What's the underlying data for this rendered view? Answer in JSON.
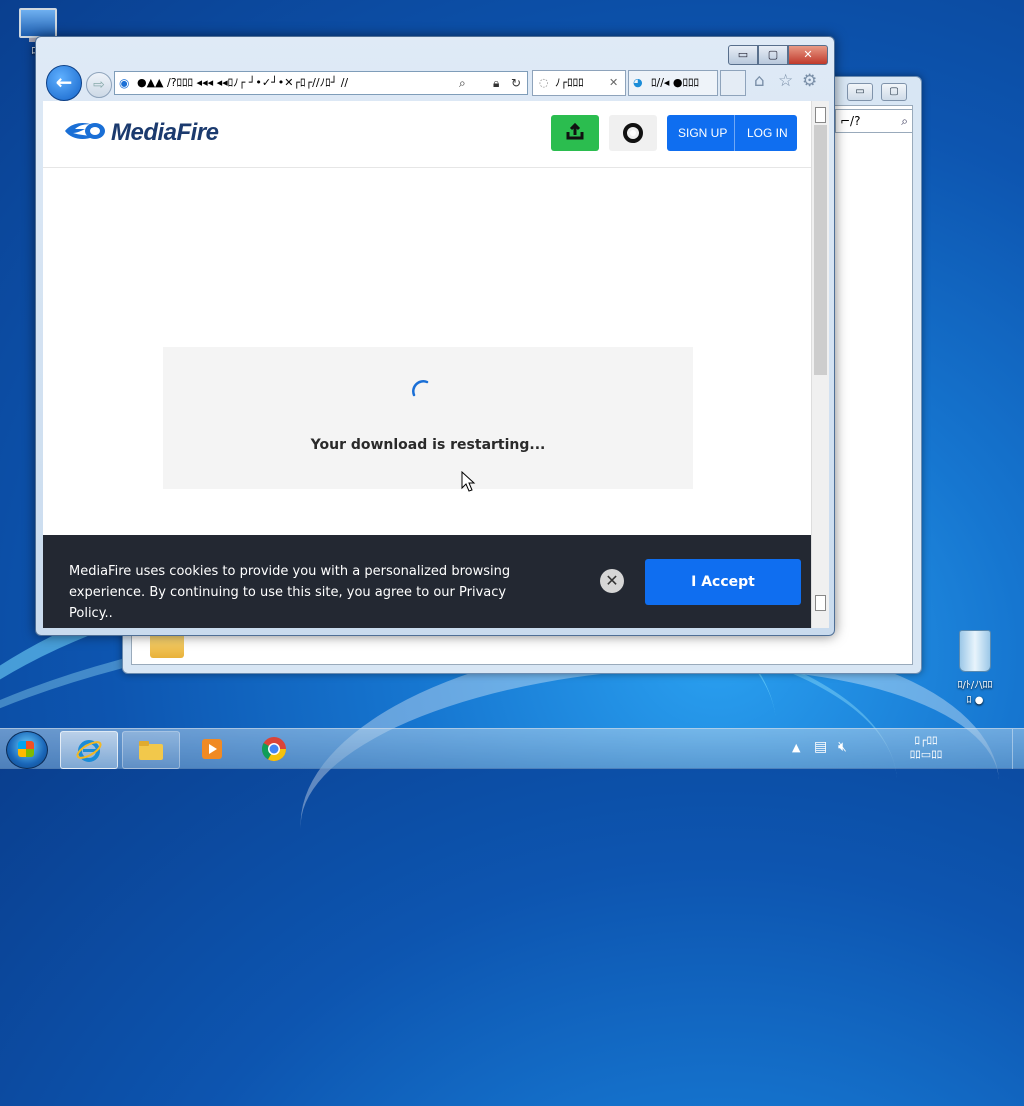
{
  "desktop": {
    "computer_label": "ﾛ/ﾉ",
    "recycle_label_line1": "ﾛ/ﾄ/ﾉ\\ﾛﾛ",
    "recycle_label_line2": "ﾛ ●"
  },
  "background_window": {
    "search_text": "⌐/?",
    "min_label": "▭",
    "max_label": "▢",
    "close_label": "✕"
  },
  "browser": {
    "window_controls": {
      "minimize": "▭",
      "maximize": "▢",
      "close": "✕"
    },
    "back_label": "←",
    "forward_label": "⇨",
    "address_text": "●▲▲ ∕?ﾛﾛﾛ ◂◂◂ ◂◂ﾛﾉ┌ ┘•✓┘•✕┌ﾛ┌∕∕ﾉﾛ┘ ∕∕",
    "tabs": [
      {
        "label": "ﾉ┌ﾛﾛﾛ",
        "close": "✕"
      },
      {
        "label": "ﾛ∕∕◂ ●ﾛﾛﾛ"
      }
    ],
    "toolbar_icons": [
      "home-icon",
      "star-icon",
      "gear-icon"
    ]
  },
  "mediafire": {
    "logo_text": "MediaFire",
    "upload_icon": "upload-icon",
    "help_icon": "lifebuoy-icon",
    "signup_label": "SIGN UP",
    "login_label": "LOG IN",
    "status_text": "Your download is restarting...",
    "cookie_text": "MediaFire uses cookies to provide you with a personalized browsing experience. By continuing to use this site, you agree to our Privacy Policy..",
    "cookie_close": "✕",
    "accept_label": "I Accept"
  },
  "colors": {
    "brand_blue": "#0f6ef0",
    "upload_green": "#2bbd4f",
    "cookie_bg": "#232832",
    "logo_navy": "#1b3a6e"
  },
  "taskbar": {
    "items": [
      "internet-explorer",
      "file-explorer",
      "media-player",
      "chrome"
    ],
    "clock_time": "ﾛ┌ﾛﾛ",
    "clock_date": "ﾛﾛ▭ﾛﾛ"
  }
}
